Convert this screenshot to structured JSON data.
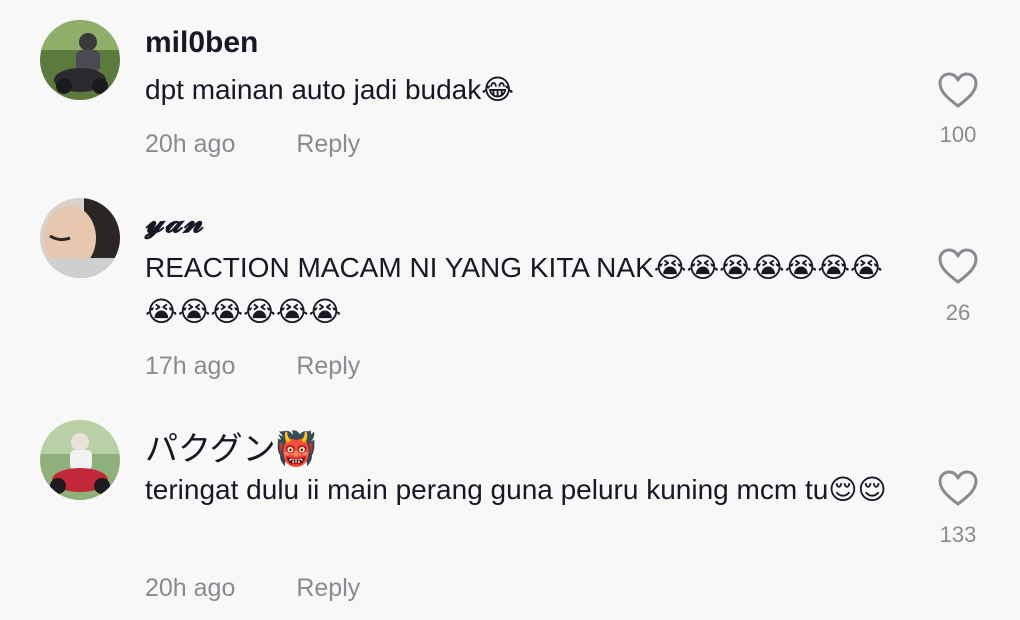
{
  "comments": [
    {
      "username": "mil0ben",
      "text": "dpt mainan auto jadi budak😂",
      "time": "20h ago",
      "reply_label": "Reply",
      "likes": "100"
    },
    {
      "username": "𝔂𝓪𝓷",
      "text": "REACTION MACAM NI YANG KITA NAK😭😭😭😭😭😭😭😭😭😭😭😭😭",
      "time": "17h ago",
      "reply_label": "Reply",
      "likes": "26"
    },
    {
      "username": "パクグン👹",
      "text": "teringat dulu ii main perang guna peluru kuning mcm tu😌😌",
      "time": "20h ago",
      "reply_label": "Reply",
      "likes": "133"
    }
  ],
  "colors": {
    "background": "#f8f8f8",
    "text_primary": "#161823",
    "text_secondary": "#8a8b91"
  },
  "icons": {
    "like": "heart-outline-icon"
  }
}
